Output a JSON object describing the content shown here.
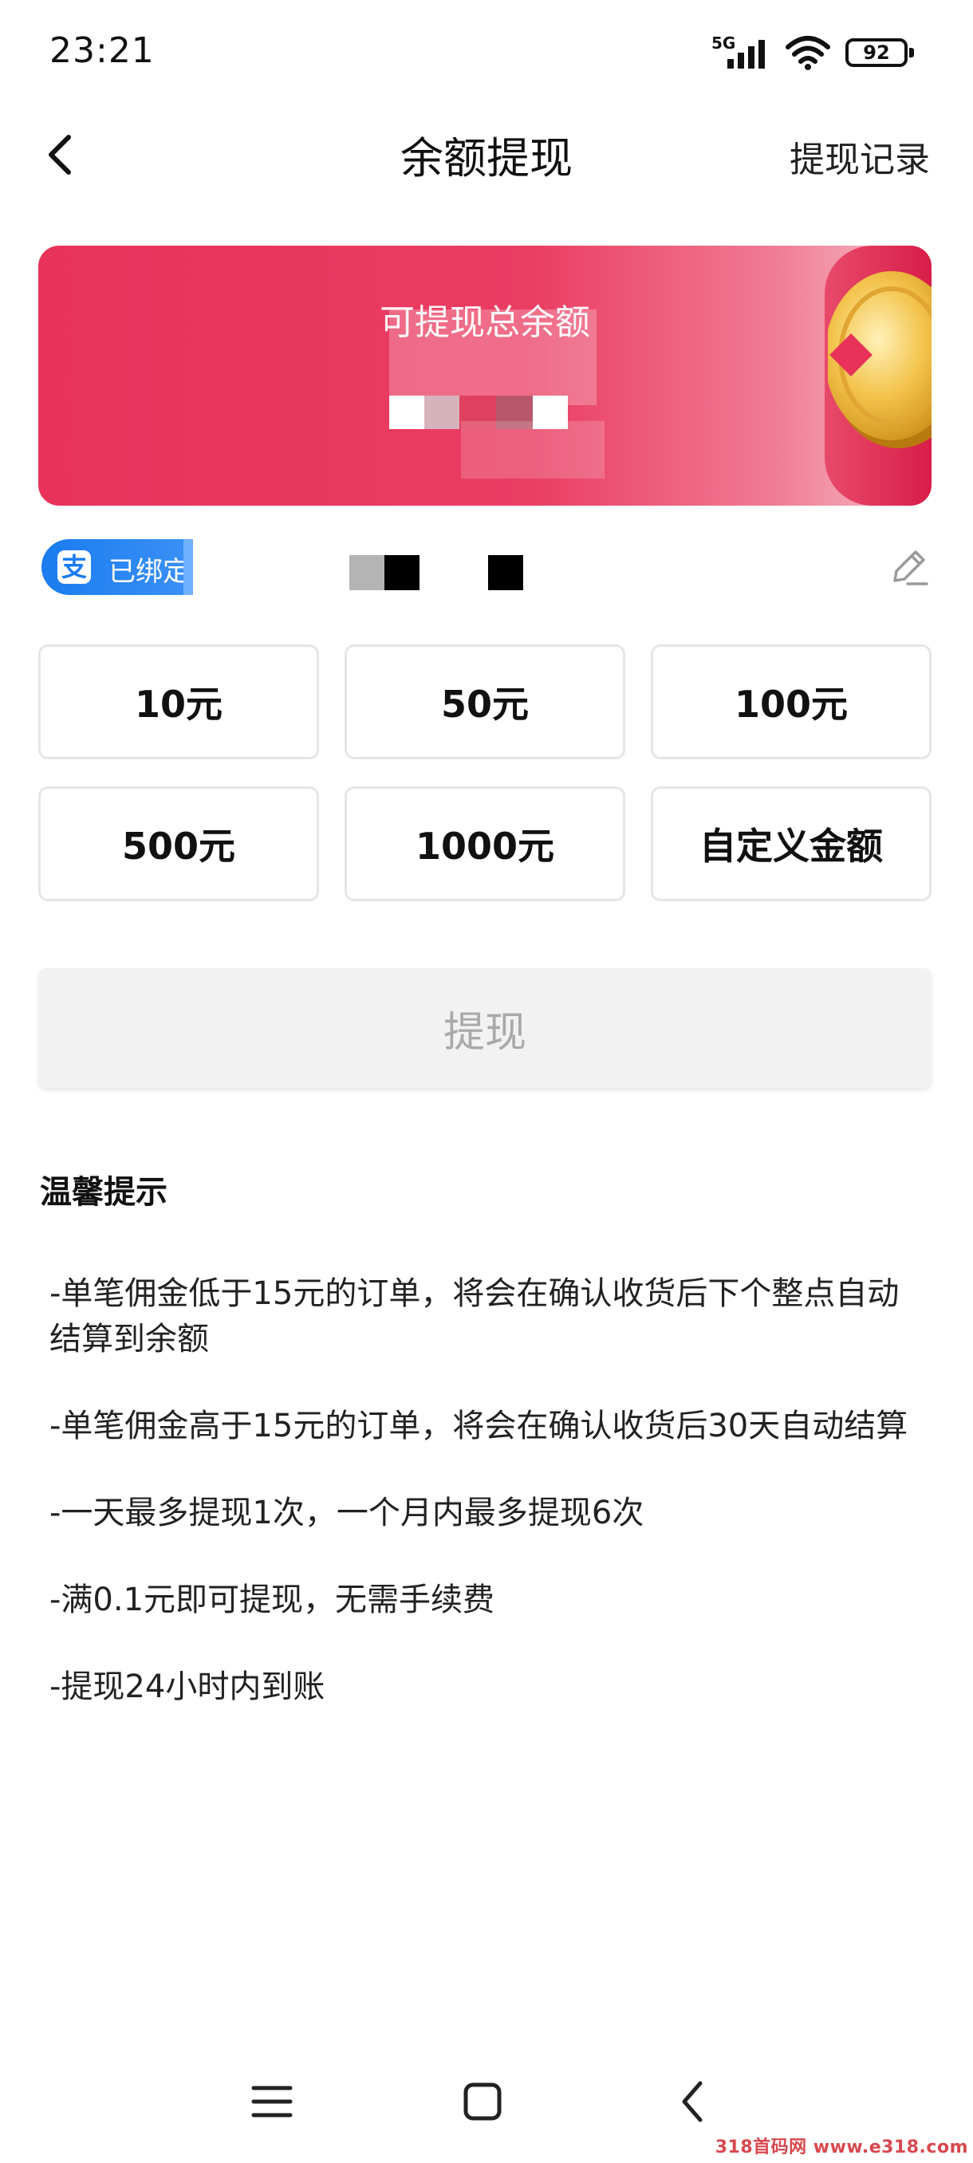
{
  "status_bar": {
    "time": "23:21",
    "network": "5G",
    "battery": "92"
  },
  "nav": {
    "title": "余额提现",
    "record_link": "提现记录"
  },
  "balance_card": {
    "label": "可提现总余额"
  },
  "account": {
    "alipay_logo": "支",
    "bound_label": "已绑定"
  },
  "amount_options": [
    {
      "label": "10元"
    },
    {
      "label": "50元"
    },
    {
      "label": "100元"
    },
    {
      "label": "500元"
    },
    {
      "label": "1000元"
    },
    {
      "label": "自定义金额"
    }
  ],
  "submit_label": "提现",
  "tips": {
    "title": "温馨提示",
    "items": [
      "-单笔佣金低于15元的订单，将会在确认收货后下个整点自动结算到余额",
      "-单笔佣金高于15元的订单，将会在确认收货后30天自动结算",
      "-一天最多提现1次，一个月内最多提现6次",
      "-满0.1元即可提现，无需手续费",
      "-提现24小时内到账"
    ]
  },
  "watermark": "318首码网 www.e318.com",
  "colors": {
    "card_red": "#e8325a",
    "alipay_blue": "#1a7cf0",
    "disabled_text": "#a9a9a9"
  }
}
